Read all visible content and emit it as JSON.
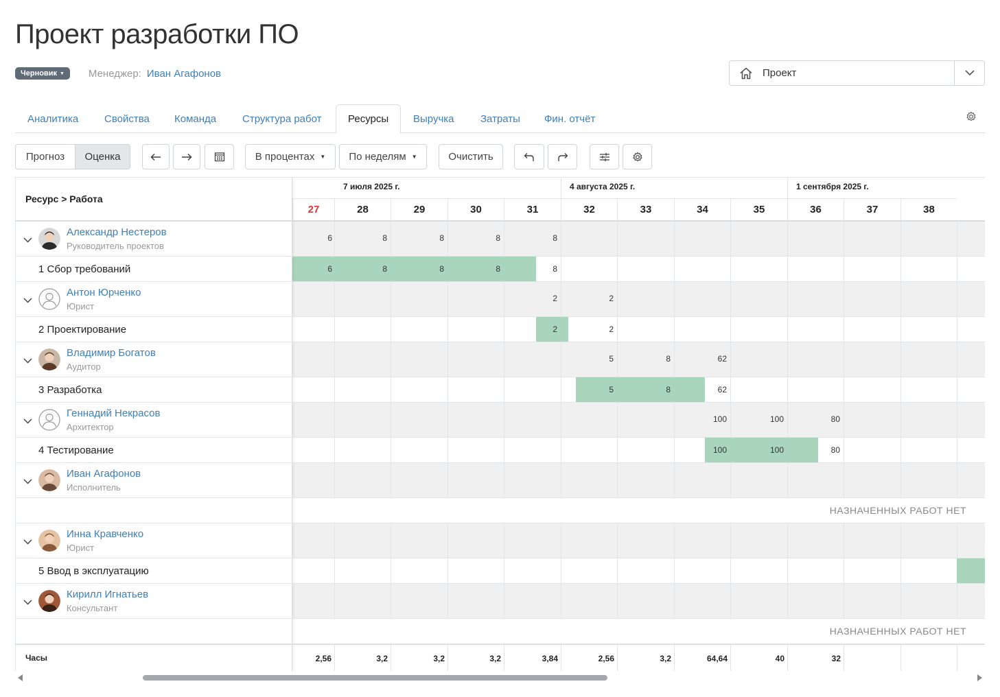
{
  "title": "Проект разработки ПО",
  "status_badge": "Черновик",
  "manager": {
    "label": "Менеджер:",
    "name": "Иван Агафонов"
  },
  "project_select": {
    "label": "Проект",
    "icon": "home-icon"
  },
  "tabs": [
    "Аналитика",
    "Свойства",
    "Команда",
    "Структура работ",
    "Ресурсы",
    "Выручка",
    "Затраты",
    "Фин. отчёт"
  ],
  "active_tab": "Ресурсы",
  "toolbar": {
    "forecast": "Прогноз",
    "estimate": "Оценка",
    "units": "В процентах",
    "period": "По неделям",
    "clear": "Очистить"
  },
  "grid": {
    "header_label": "Ресурс > Работа",
    "months": [
      "7 июля 2025 г.",
      "4 августа 2025 г.",
      "1 сентября 2025 г."
    ],
    "weeks": [
      "27",
      "28",
      "29",
      "30",
      "31",
      "32",
      "33",
      "34",
      "35",
      "36",
      "37",
      "38"
    ],
    "resources": [
      {
        "name": "Александр Нестеров",
        "role": "Руководитель проектов",
        "values": [
          "6",
          "8",
          "8",
          "8",
          "8"
        ],
        "task": "1 Сбор требований",
        "task_values": [
          "6",
          "8",
          "8",
          "8",
          "8"
        ]
      },
      {
        "name": "Антон Юрченко",
        "role": "Юрист",
        "values": [
          "2",
          "2"
        ],
        "task": "2 Проектирование",
        "task_values": [
          "2",
          "2"
        ]
      },
      {
        "name": "Владимир Богатов",
        "role": "Аудитор",
        "values": [
          "5",
          "8",
          "62"
        ],
        "task": "3 Разработка",
        "task_values": [
          "5",
          "8",
          "62"
        ]
      },
      {
        "name": "Геннадий Некрасов",
        "role": "Архитектор",
        "values": [
          "100",
          "100",
          "80"
        ],
        "task": "4 Тестирование",
        "task_values": [
          "100",
          "100",
          "80"
        ]
      },
      {
        "name": "Иван Агафонов",
        "role": "Исполнитель",
        "empty_text": "НАЗНАЧЕННЫХ РАБОТ НЕТ"
      },
      {
        "name": "Инна Кравченко",
        "role": "Юрист",
        "task": "5 Ввод в эксплуатацию"
      },
      {
        "name": "Кирилл Игнатьев",
        "role": "Консультант",
        "empty_text": "НАЗНАЧЕННЫХ РАБОТ НЕТ"
      }
    ],
    "footer_label": "Часы",
    "footer_values": [
      "2,56",
      "3,2",
      "3,2",
      "3,2",
      "3,84",
      "2,56",
      "3,2",
      "64,64",
      "40",
      "32"
    ]
  },
  "colors": {
    "accent": "#3f7fb8",
    "bar": "#a8d5bb",
    "red_week": "#d9363e",
    "badge": "#5f6b76"
  }
}
